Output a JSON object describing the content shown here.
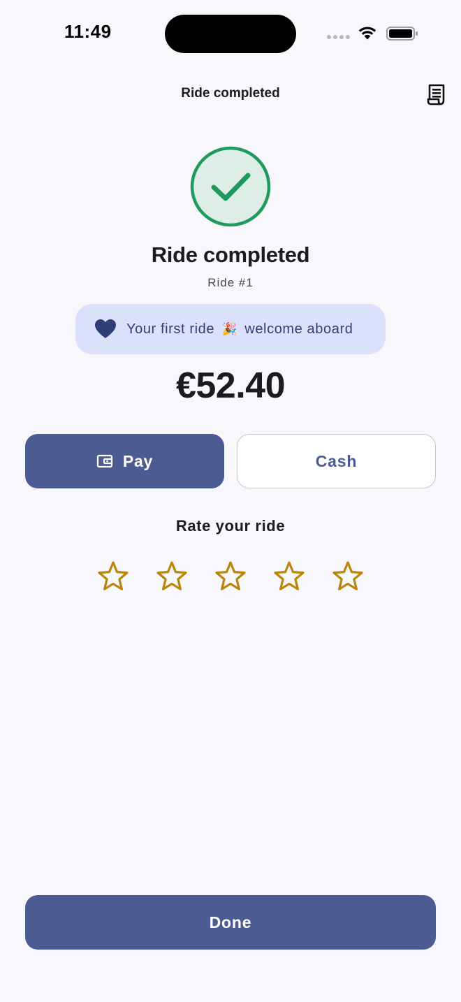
{
  "status_bar": {
    "time": "11:49"
  },
  "header": {
    "title": "Ride completed",
    "receipt_icon": "receipt-icon"
  },
  "success": {
    "icon": "checkmark-circle-icon",
    "title": "Ride completed",
    "ride_number": "Ride #1"
  },
  "banner": {
    "icon": "heart-icon",
    "text_before": "Your first ride",
    "emoji": "🎉",
    "text_after": "welcome aboard"
  },
  "price": "€52.40",
  "payment": {
    "pay_label": "Pay",
    "pay_icon": "wallet-icon",
    "cash_label": "Cash"
  },
  "rating": {
    "label": "Rate your ride",
    "max_stars": 5,
    "selected": 0
  },
  "done_label": "Done",
  "colors": {
    "background": "#F8F7FC",
    "primary": "#4C5B92",
    "success": "#1E9B5C",
    "success_bg": "#DDEEE7",
    "banner_bg": "#DCE1FB",
    "banner_text": "#2F3E75",
    "star": "#B8860B"
  }
}
